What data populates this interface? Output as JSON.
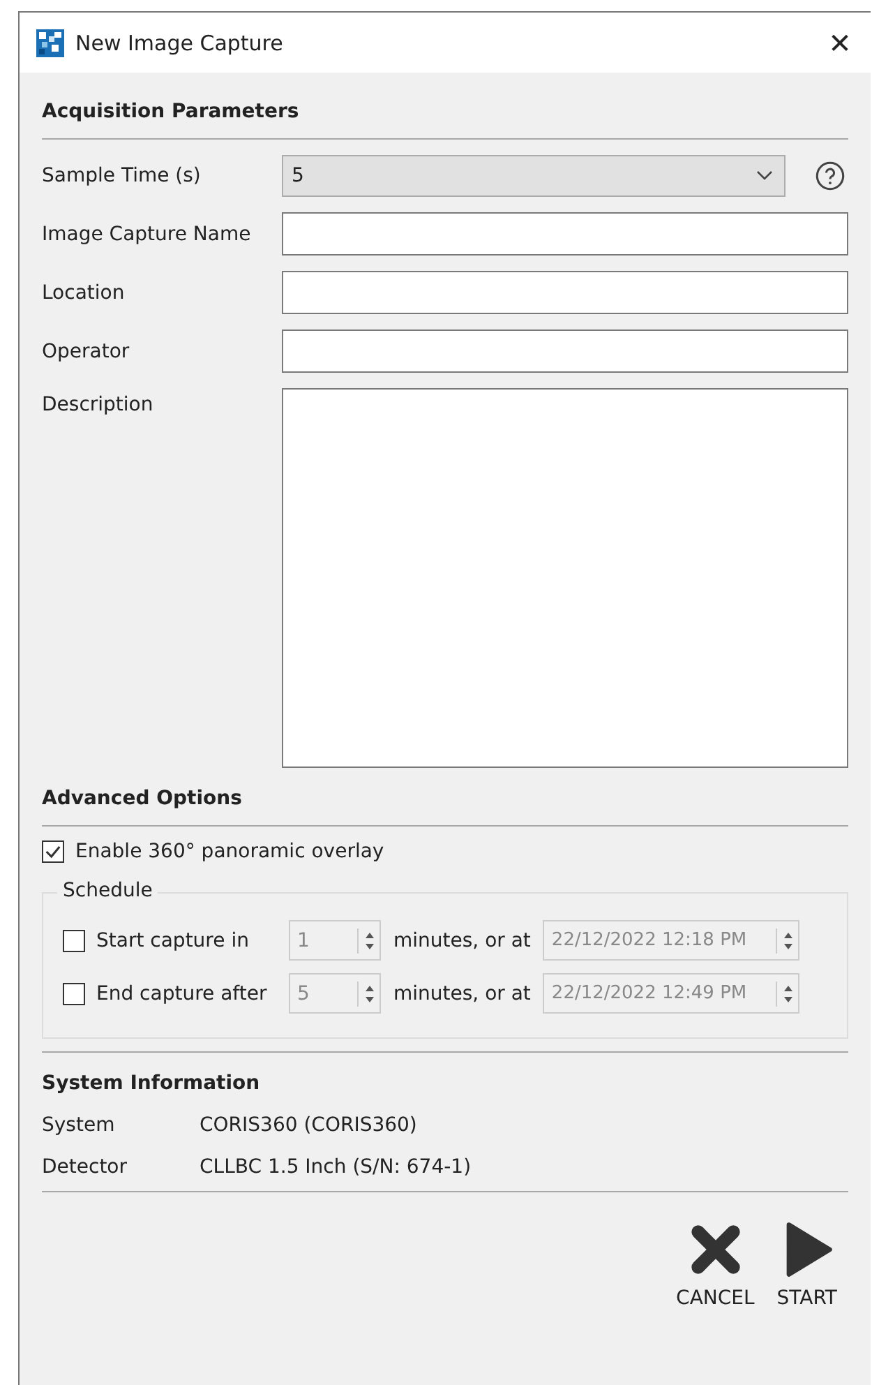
{
  "window": {
    "title": "New Image Capture",
    "close": "✕"
  },
  "acquisition": {
    "heading": "Acquisition Parameters",
    "sample_time": {
      "label": "Sample Time (s)",
      "value": "5"
    },
    "fields": [
      {
        "label": "Image Capture Name"
      },
      {
        "label": "Location"
      },
      {
        "label": "Operator"
      }
    ],
    "description": {
      "label": "Description"
    }
  },
  "advanced": {
    "heading": "Advanced Options",
    "panoramic": {
      "label": "Enable 360° panoramic overlay",
      "checked": true
    },
    "schedule": {
      "title": "Schedule",
      "rows": [
        {
          "label": "Start capture in",
          "checked": false,
          "minutes": "1",
          "between": "minutes, or at",
          "datetime": "22/12/2022 12:18 PM"
        },
        {
          "label": "End capture after",
          "checked": false,
          "minutes": "5",
          "between": "minutes, or at",
          "datetime": "22/12/2022 12:49 PM"
        }
      ]
    }
  },
  "system_information": {
    "heading": "System Information",
    "rows": [
      {
        "label": "System",
        "value": "CORIS360 (CORIS360)"
      },
      {
        "label": "Detector",
        "value": "CLLBC 1.5 Inch (S/N: 674-1)"
      }
    ]
  },
  "buttons": [
    {
      "kind": "cancel",
      "label": "CANCEL"
    },
    {
      "kind": "start",
      "label": "START"
    }
  ]
}
